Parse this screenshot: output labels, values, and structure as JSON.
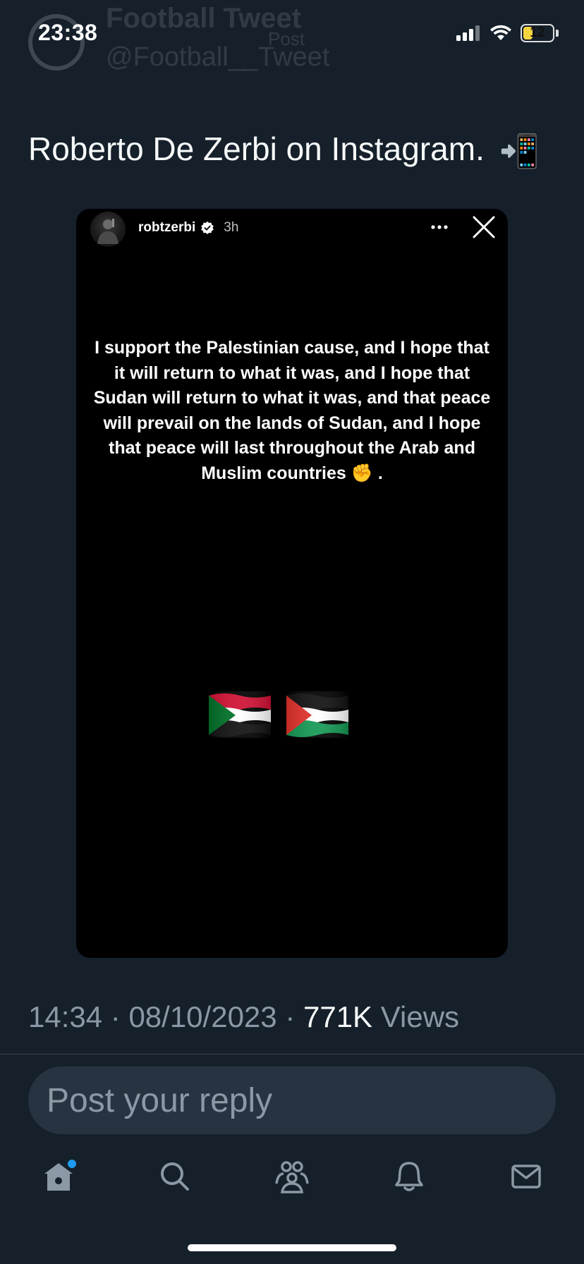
{
  "status_bar": {
    "time": "23:38",
    "battery_level": "12",
    "battery_percent": 12
  },
  "faded_header": {
    "name": "Football Tweet",
    "handle": "@Football__Tweet",
    "title": "Post"
  },
  "tweet": {
    "text": "Roberto De Zerbi on Instagram.",
    "emoji": "📲"
  },
  "story": {
    "username": "robtzerbi",
    "time_ago": "3h",
    "message": "I support the Palestinian cause, and I hope that it will return to what it was, and I hope that Sudan will return to what it was, and that peace will prevail on the lands of Sudan, and I hope that peace will last throughout the Arab and Muslim countries ✊ .",
    "flags": [
      "sudan-flag",
      "palestine-flag"
    ]
  },
  "meta": {
    "time": "14:34",
    "separator": " · ",
    "date": "08/10/2023",
    "views_count": "771K",
    "views_label": " Views"
  },
  "reply": {
    "placeholder": "Post your reply"
  },
  "nav": {
    "items": [
      "home-icon",
      "search-icon",
      "communities-icon",
      "notifications-icon",
      "messages-icon"
    ],
    "active": "home-icon"
  },
  "colors": {
    "background": "#15202b",
    "text_secondary": "#8b98a5",
    "accent": "#1d9bf0",
    "reply_bg": "#273340"
  }
}
